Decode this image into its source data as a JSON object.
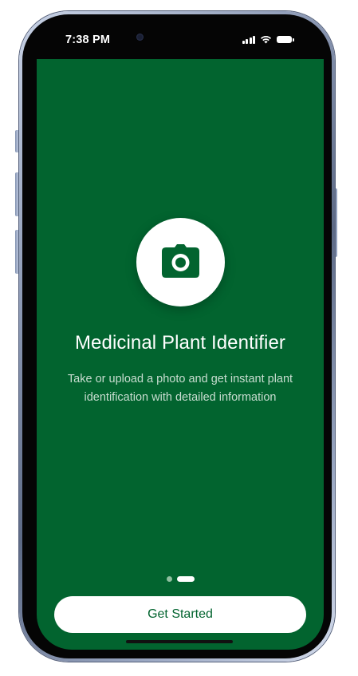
{
  "status_bar": {
    "time": "7:38 PM",
    "icons": [
      "signal-icon",
      "wifi-icon",
      "battery-icon"
    ]
  },
  "onboarding": {
    "icon": "camera-icon",
    "title": "Medicinal Plant Identifier",
    "subtitle": "Take or upload a photo and get instant plant identification with detailed information",
    "page_count": 2,
    "active_page": 2
  },
  "actions": {
    "get_started_label": "Get Started"
  },
  "colors": {
    "background": "#02642f",
    "button_text": "#02642f",
    "button_bg": "#ffffff",
    "subtitle": "#c8ddd0"
  }
}
